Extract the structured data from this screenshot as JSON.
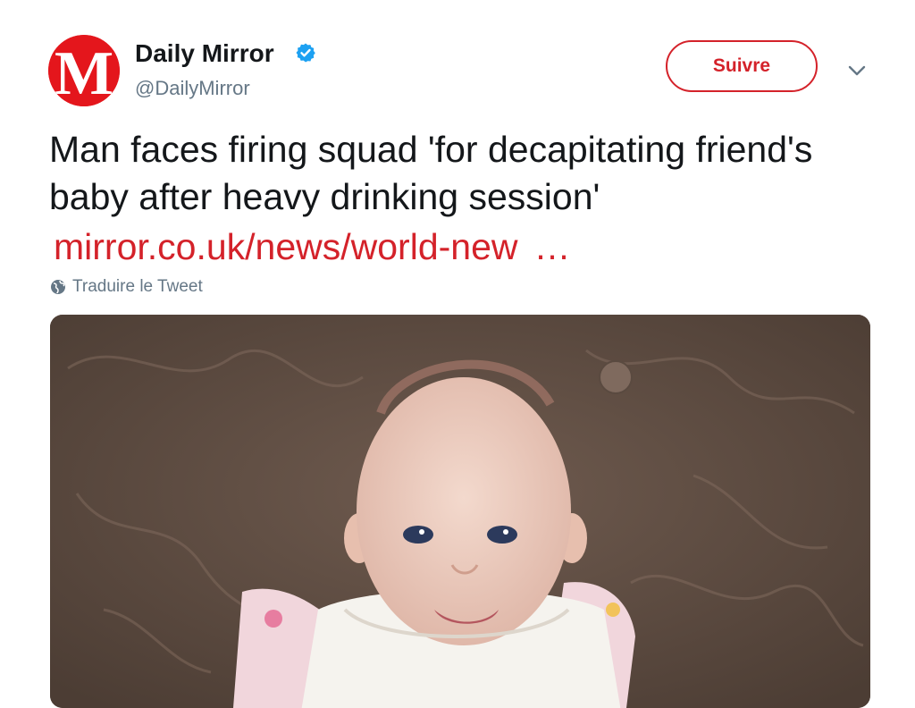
{
  "author": {
    "name": "Daily Mirror",
    "handle": "@DailyMirror",
    "verified": true,
    "avatar_icon": "daily-mirror-logo",
    "avatar_letter": "M"
  },
  "follow_button": {
    "label": "Suivre"
  },
  "tweet": {
    "text": "Man faces firing squad 'for decapitating friend's baby after heavy drinking session'",
    "link_text": "mirror.co.uk/news/world-new",
    "link_ellipsis": "…"
  },
  "translate": {
    "label": "Traduire le Tweet",
    "icon": "globe-icon"
  },
  "media": {
    "type": "photo"
  },
  "colors": {
    "brand_red": "#d4222a",
    "avatar_red": "#e4161c",
    "verified_blue": "#1da1f2",
    "secondary_text": "#657786"
  }
}
